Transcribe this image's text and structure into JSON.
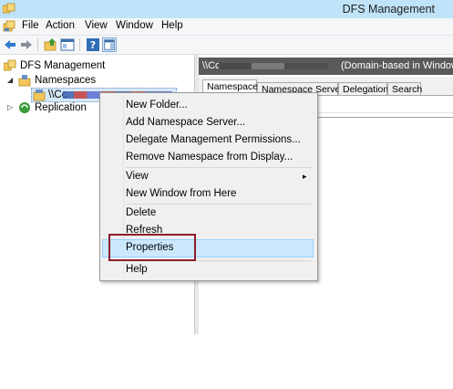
{
  "window": {
    "title": "DFS Management"
  },
  "menu": {
    "items": [
      "File",
      "Action",
      "View",
      "Window",
      "Help"
    ]
  },
  "toolbar": {
    "buttons": [
      "back-arrow-icon",
      "forward-arrow-icon",
      "up-folder-icon",
      "show-hide-tree-icon",
      "help-icon",
      "properties-pane-icon"
    ]
  },
  "tree": {
    "root": "DFS Management",
    "namespaces": "Namespaces",
    "namespace_item": "\\\\Cc",
    "replication": "Replication"
  },
  "right_pane": {
    "header_path": "\\\\Cc",
    "header_type": "(Domain-based in Windows",
    "tabs": [
      "Namespace",
      "Namespace Servers",
      "Delegation",
      "Search"
    ],
    "active_tab": "Namespace"
  },
  "context_menu": {
    "items": [
      "New Folder...",
      "Add Namespace Server...",
      "Delegate Management Permissions...",
      "Remove Namespace from Display...",
      "View",
      "New Window from Here",
      "Delete",
      "Refresh",
      "Properties",
      "Help"
    ],
    "submenu_arrow": "▸",
    "highlighted": "Properties",
    "highlight_color": "#cce8ff",
    "annotation_color": "#8b1e2b"
  }
}
